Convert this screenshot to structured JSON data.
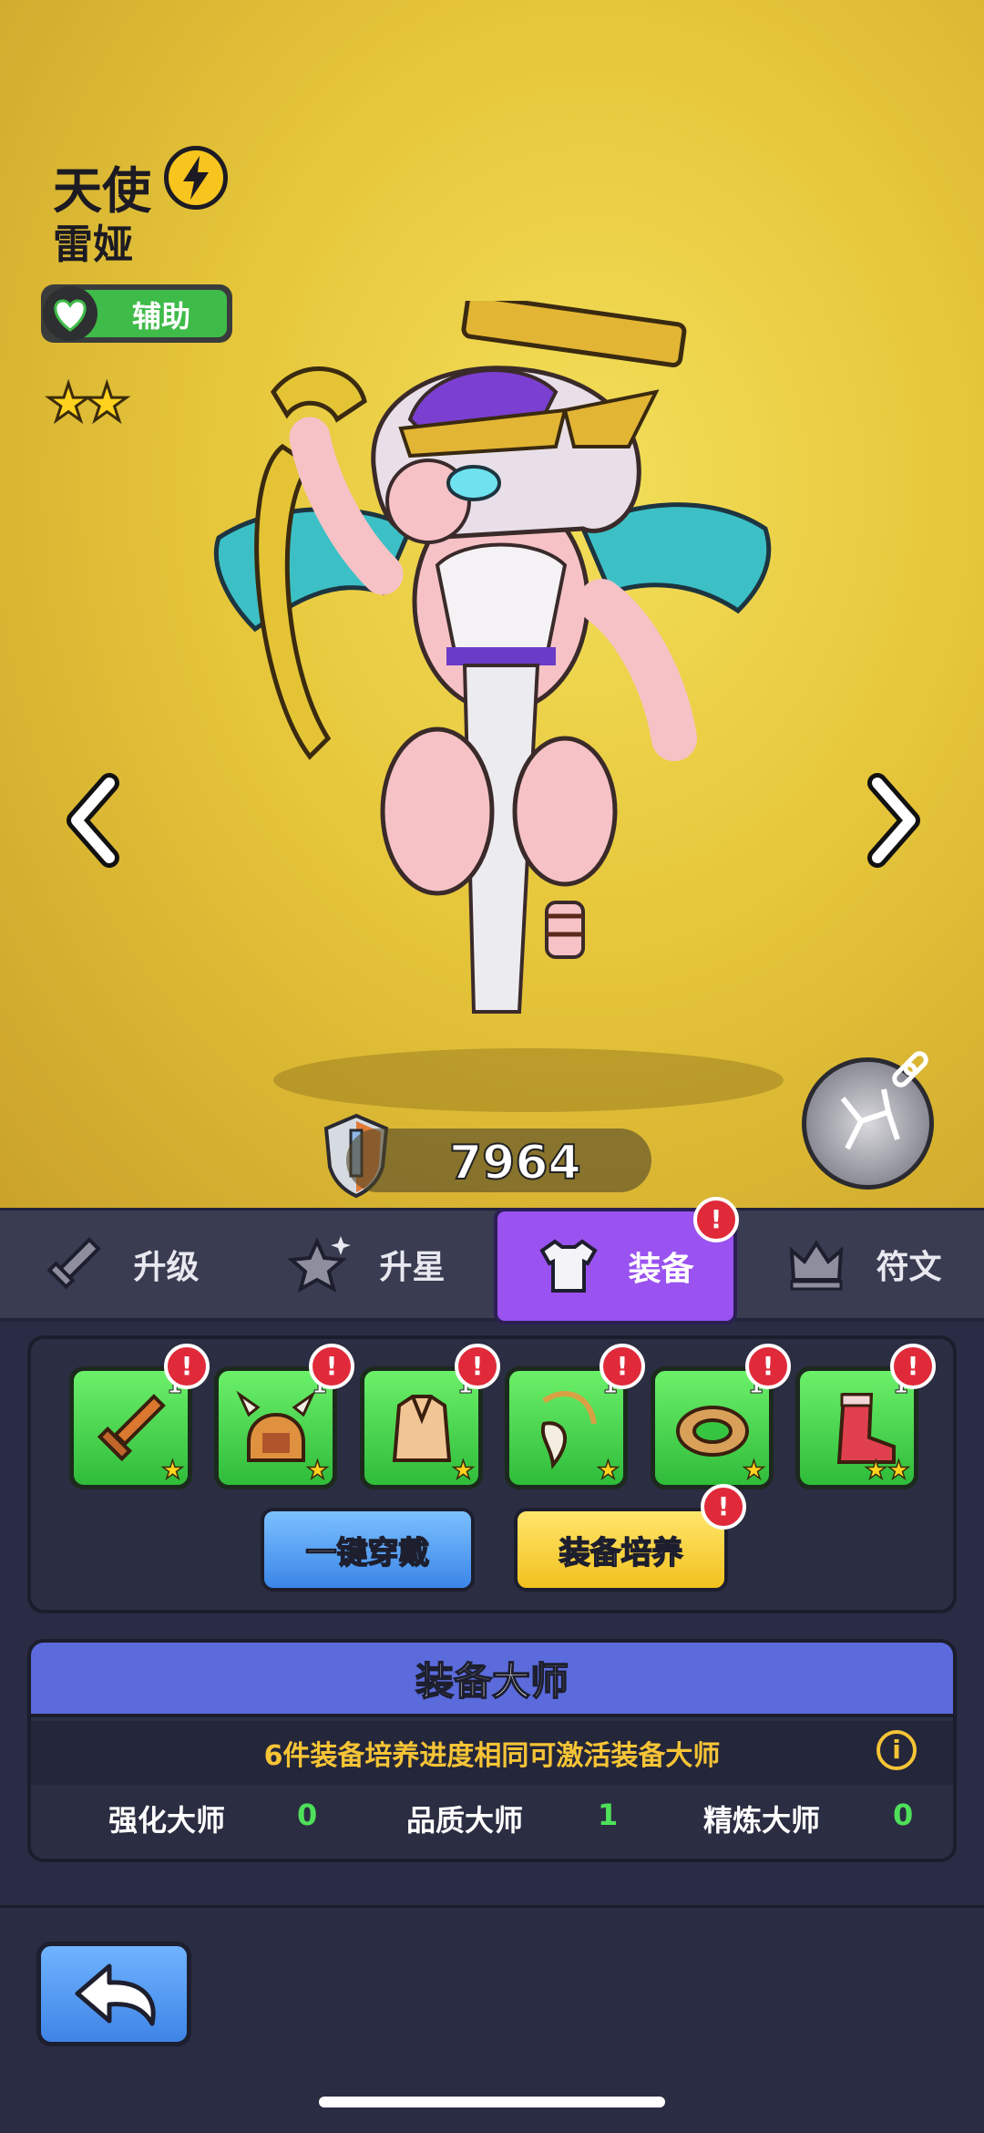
{
  "hero": {
    "title": "天使",
    "name": "雷娅",
    "role": "辅助",
    "stars": 2,
    "power": "7964"
  },
  "tabs": [
    {
      "label": "升级",
      "icon": "sword-icon",
      "active": false
    },
    {
      "label": "升星",
      "icon": "star-icon",
      "active": false
    },
    {
      "label": "装备",
      "icon": "armor-icon",
      "active": true
    },
    {
      "label": "符文",
      "icon": "crown-icon",
      "active": false
    }
  ],
  "badge_symbol": "!",
  "equipment": {
    "slots": [
      {
        "name": "sword",
        "level": "1",
        "stars": "★"
      },
      {
        "name": "helmet",
        "level": "1",
        "stars": "★"
      },
      {
        "name": "vest",
        "level": "1",
        "stars": "★"
      },
      {
        "name": "necklace",
        "level": "1",
        "stars": "★"
      },
      {
        "name": "ring",
        "level": "1",
        "stars": "★"
      },
      {
        "name": "boot",
        "level": "1",
        "stars": "★★"
      }
    ],
    "equip_all_label": "一键穿戴",
    "upgrade_label": "装备培养"
  },
  "master": {
    "title": "装备大师",
    "note": "6件装备培养进度相同可激活装备大师",
    "info": "i",
    "items": [
      {
        "label": "强化大师",
        "value": "0"
      },
      {
        "label": "品质大师",
        "value": "1"
      },
      {
        "label": "精炼大师",
        "value": "0"
      }
    ]
  },
  "colors": {
    "accent_purple": "#9a52f0",
    "slot_green": "#3fcf45",
    "badge_red": "#e02a3a",
    "master_blue": "#5b6bdc",
    "note_yellow": "#f6c436"
  }
}
